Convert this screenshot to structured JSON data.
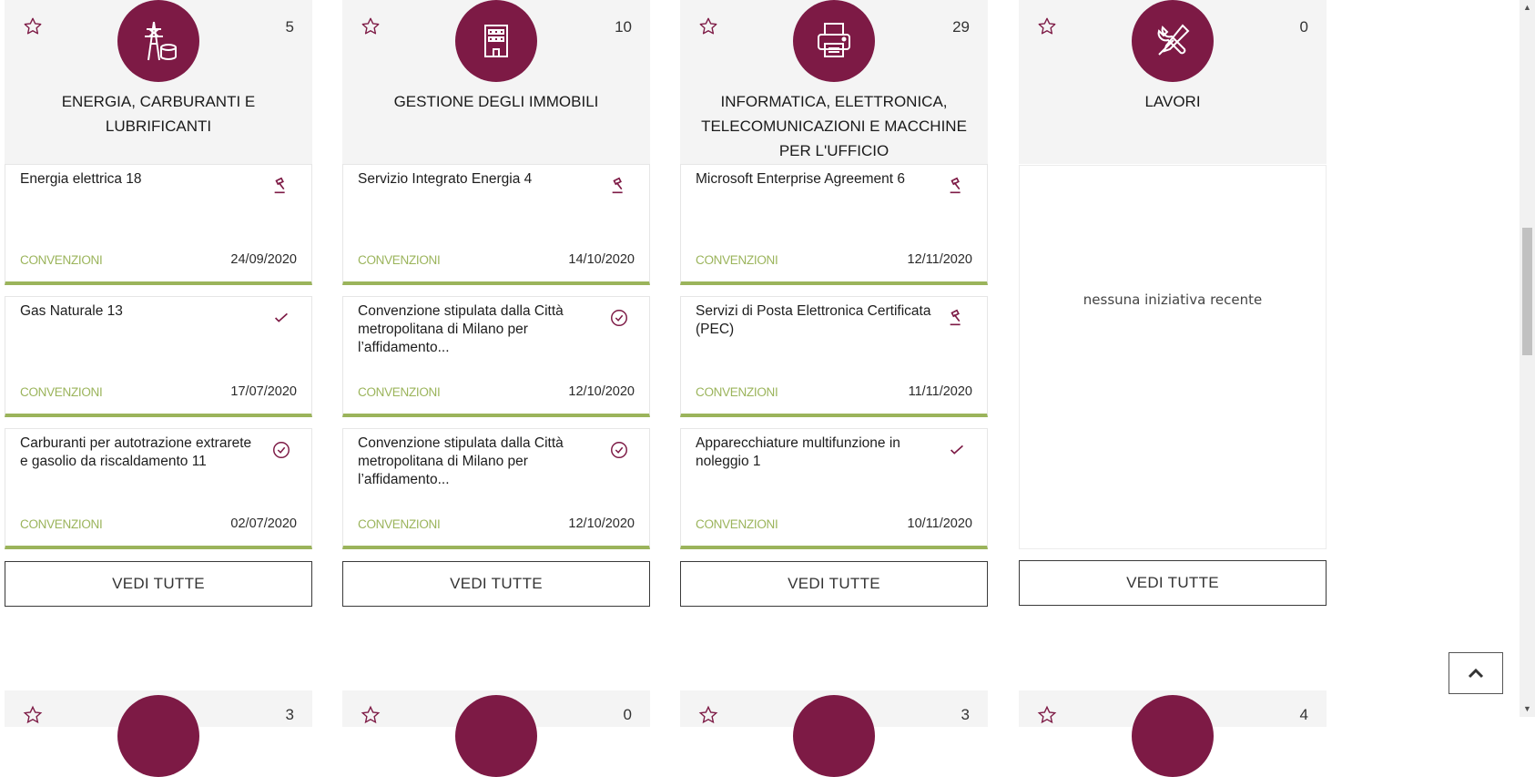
{
  "categories": [
    {
      "title": "ENERGIA, CARBURANTI E LUBRIFICANTI",
      "count": "5",
      "icon": "power-tower-icon",
      "cards": [
        {
          "title": "Energia elettrica 18",
          "type": "CONVENZIONI",
          "date": "24/09/2020",
          "status_icon": "gavel-icon"
        },
        {
          "title": "Gas Naturale 13",
          "type": "CONVENZIONI",
          "date": "17/07/2020",
          "status_icon": "checkmark-icon"
        },
        {
          "title": "Carburanti per autotrazione extrarete e gasolio da riscaldamento 11",
          "type": "CONVENZIONI",
          "date": "02/07/2020",
          "status_icon": "check-circle-icon"
        }
      ],
      "button": "VEDI TUTTE"
    },
    {
      "title": "GESTIONE DEGLI IMMOBILI",
      "count": "10",
      "icon": "building-icon",
      "cards": [
        {
          "title": "Servizio Integrato Energia 4",
          "type": "CONVENZIONI",
          "date": "14/10/2020",
          "status_icon": "gavel-icon"
        },
        {
          "title": "Convenzione stipulata dalla Città metropolitana di Milano per l’affidamento...",
          "type": "CONVENZIONI",
          "date": "12/10/2020",
          "status_icon": "check-circle-icon"
        },
        {
          "title": "Convenzione stipulata dalla Città metropolitana di Milano per l’affidamento...",
          "type": "CONVENZIONI",
          "date": "12/10/2020",
          "status_icon": "check-circle-icon"
        }
      ],
      "button": "VEDI TUTTE"
    },
    {
      "title": "INFORMATICA, ELETTRONICA, TELECOMUNICAZIONI E MACCHINE PER L'UFFICIO",
      "count": "29",
      "icon": "printer-icon",
      "cards": [
        {
          "title": "Microsoft Enterprise Agreement 6",
          "type": "CONVENZIONI",
          "date": "12/11/2020",
          "status_icon": "gavel-icon"
        },
        {
          "title": "Servizi di Posta Elettronica Certificata (PEC)",
          "type": "CONVENZIONI",
          "date": "11/11/2020",
          "status_icon": "gavel-icon"
        },
        {
          "title": "Apparecchiature multifunzione in noleggio 1",
          "type": "CONVENZIONI",
          "date": "10/11/2020",
          "status_icon": "checkmark-icon"
        }
      ],
      "button": "VEDI TUTTE"
    },
    {
      "title": "LAVORI",
      "count": "0",
      "icon": "tools-icon",
      "empty_text": "nessuna iniziativa recente",
      "button": "VEDI TUTTE"
    }
  ],
  "second_row_counts": [
    "3",
    "0",
    "3",
    "4"
  ],
  "colors": {
    "brand": "#7d1a45",
    "accent_green": "#9bb45b"
  }
}
